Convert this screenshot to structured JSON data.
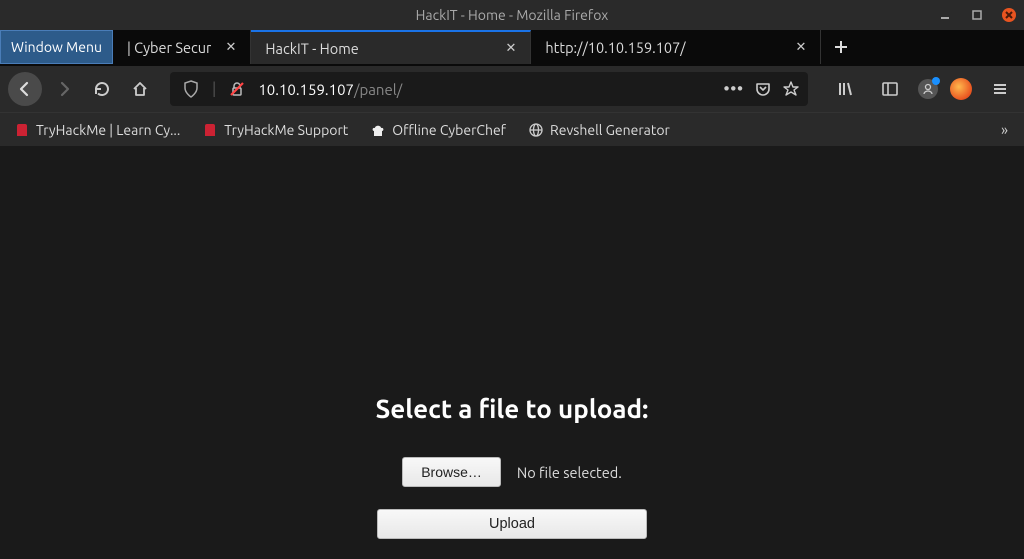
{
  "window": {
    "title": "HackIT - Home - Mozilla Firefox"
  },
  "tabs": {
    "window_menu": "Window Menu",
    "items": [
      {
        "title": "| Cyber Secur"
      },
      {
        "title": "HackIT - Home"
      },
      {
        "title": "http://10.10.159.107/"
      }
    ]
  },
  "url": {
    "host": "10.10.159.107",
    "path": "/panel/"
  },
  "bookmarks": {
    "items": [
      {
        "label": "TryHackMe | Learn Cy..."
      },
      {
        "label": "TryHackMe Support"
      },
      {
        "label": "Offline CyberChef"
      },
      {
        "label": "Revshell Generator"
      }
    ]
  },
  "page": {
    "heading": "Select a file to upload:",
    "browse_label": "Browse…",
    "file_status": "No file selected.",
    "upload_label": "Upload"
  }
}
